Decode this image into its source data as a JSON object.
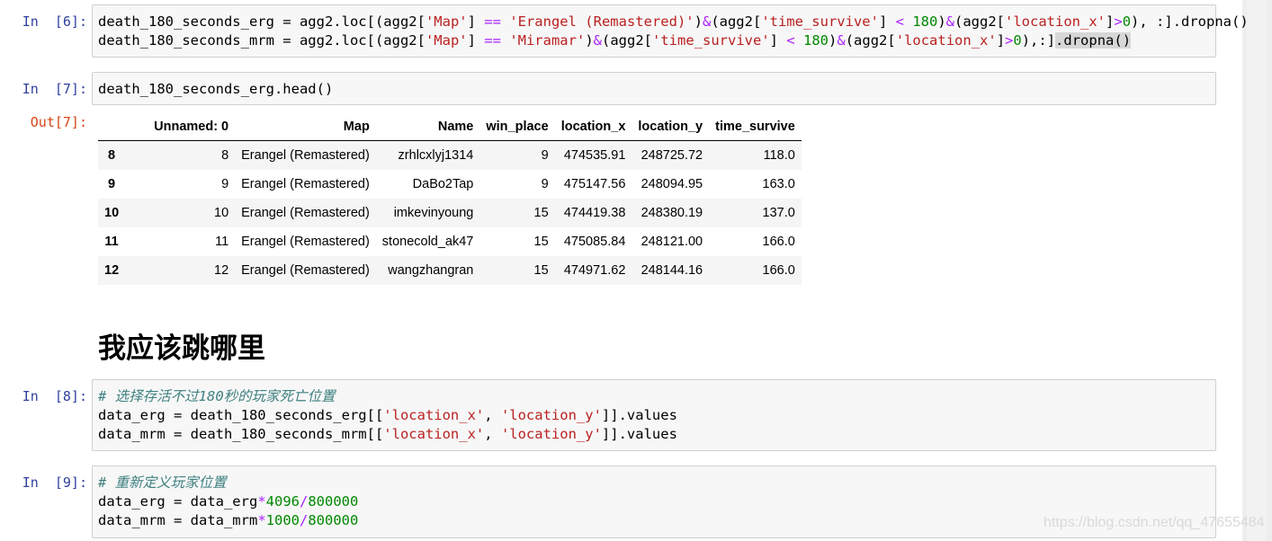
{
  "cells": {
    "c6": {
      "prompt": "In  [6]:",
      "line1": {
        "p1": "death_180_seconds_erg = agg2.loc[(agg2[",
        "s1": "'Map'",
        "p2": "] ",
        "o1": "==",
        "p3": " ",
        "s2": "'Erangel (Remastered)'",
        "p4": ")",
        "o2": "&",
        "p5": "(agg2[",
        "s3": "'time_survive'",
        "p6": "] ",
        "o3": "<",
        "p7": " ",
        "n1": "180",
        "p8": ")",
        "o4": "&",
        "p9": "(agg2[",
        "s4": "'location_x'",
        "p10": "]",
        "o5": ">",
        "n2": "0",
        "p11": "), :].dropna()"
      },
      "line2": {
        "p1": "death_180_seconds_mrm = agg2.loc[(agg2[",
        "s1": "'Map'",
        "p2": "] ",
        "o1": "==",
        "p3": " ",
        "s2": "'Miramar'",
        "p4": ")",
        "o2": "&",
        "p5": "(agg2[",
        "s3": "'time_survive'",
        "p6": "] ",
        "o3": "<",
        "p7": " ",
        "n1": "180",
        "p8": ")",
        "o4": "&",
        "p9": "(agg2[",
        "s4": "'location_x'",
        "p10": "]",
        "o5": ">",
        "n2": "0",
        "p11": "),:]",
        "hl": ".dropna()"
      }
    },
    "c7": {
      "prompt": "In  [7]:",
      "line1": "death_180_seconds_erg.head()",
      "out_prompt": "Out[7]:",
      "table": {
        "columns": [
          "",
          "Unnamed: 0",
          "Map",
          "Name",
          "win_place",
          "location_x",
          "location_y",
          "time_survive"
        ],
        "rows": [
          [
            "8",
            "8",
            "Erangel (Remastered)",
            "zrhlcxlyj1314",
            "9",
            "474535.91",
            "248725.72",
            "118.0"
          ],
          [
            "9",
            "9",
            "Erangel (Remastered)",
            "DaBo2Tap",
            "9",
            "475147.56",
            "248094.95",
            "163.0"
          ],
          [
            "10",
            "10",
            "Erangel (Remastered)",
            "imkevinyoung",
            "15",
            "474419.38",
            "248380.19",
            "137.0"
          ],
          [
            "11",
            "11",
            "Erangel (Remastered)",
            "stonecold_ak47",
            "15",
            "475085.84",
            "248121.00",
            "166.0"
          ],
          [
            "12",
            "12",
            "Erangel (Remastered)",
            "wangzhangran",
            "15",
            "474971.62",
            "248144.16",
            "166.0"
          ]
        ]
      }
    },
    "md": {
      "heading": "我应该跳哪里"
    },
    "c8": {
      "prompt": "In  [8]:",
      "comment": "# 选择存活不过180秒的玩家死亡位置",
      "line2": {
        "p1": "data_erg = death_180_seconds_erg[[",
        "s1": "'location_x'",
        "p2": ", ",
        "s2": "'location_y'",
        "p3": "]].values"
      },
      "line3": {
        "p1": "data_mrm = death_180_seconds_mrm[[",
        "s1": "'location_x'",
        "p2": ", ",
        "s2": "'location_y'",
        "p3": "]].values"
      }
    },
    "c9": {
      "prompt": "In  [9]:",
      "comment": "# 重新定义玩家位置",
      "line2": {
        "p1": "data_erg = data_erg",
        "o1": "*",
        "n1": "4096",
        "o2": "/",
        "n2": "800000"
      },
      "line3": {
        "p1": "data_mrm = data_mrm",
        "o1": "*",
        "n1": "1000",
        "o2": "/",
        "n2": "800000"
      }
    }
  },
  "watermark": "https://blog.csdn.net/qq_47655484",
  "colors": {
    "prompt_in": "#303f9f",
    "prompt_out": "#d84315",
    "string": "#ba2121",
    "number": "#008800",
    "operator": "#aa22ff",
    "comment": "#408080"
  }
}
